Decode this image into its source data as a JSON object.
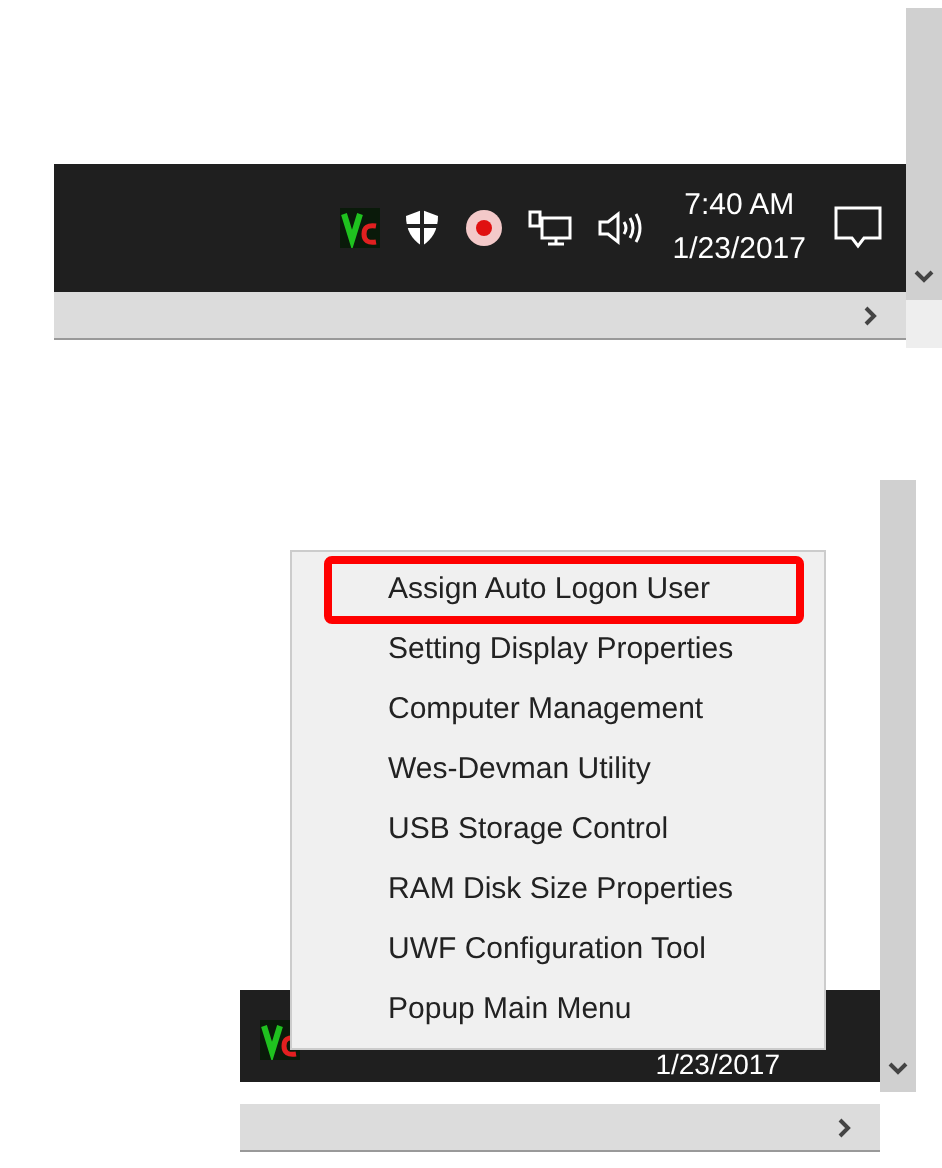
{
  "top_screen": {
    "taskbar": {
      "time": "7:40 AM",
      "date": "1/23/2017"
    }
  },
  "bottom_screen": {
    "taskbar": {
      "date": "1/23/2017"
    },
    "context_menu": {
      "items": [
        {
          "label": "Assign Auto Logon User",
          "highlighted": true
        },
        {
          "label": "Setting Display Properties",
          "highlighted": false
        },
        {
          "label": "Computer Management",
          "highlighted": false
        },
        {
          "label": "Wes-Devman Utility",
          "highlighted": false
        },
        {
          "label": "USB Storage Control",
          "highlighted": false
        },
        {
          "label": "RAM Disk Size Properties",
          "highlighted": false
        },
        {
          "label": "UWF Configuration Tool",
          "highlighted": false
        },
        {
          "label": "Popup Main Menu",
          "highlighted": false
        }
      ]
    }
  }
}
